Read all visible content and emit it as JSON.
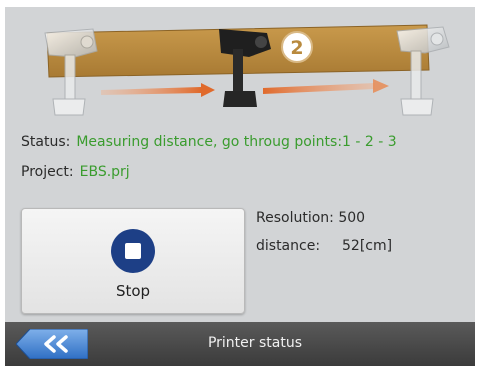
{
  "colors": {
    "screen_bg": "#d2d4d6",
    "status_green": "#3a9c2e",
    "accent_blue": "#1d3f86",
    "bar_dark": "#3b3b3b",
    "beam": "#b98a3e",
    "arrow": "#e8874a"
  },
  "illustration": {
    "step_number": "2"
  },
  "status": {
    "label": "Status:",
    "value": "Measuring distance, go throug points:1 - 2 - 3"
  },
  "project": {
    "label": "Project:",
    "value": "EBS.prj"
  },
  "stop_button": {
    "label": "Stop",
    "icon": "stop-icon"
  },
  "info": {
    "resolution_label": "Resolution:",
    "resolution_value": "500",
    "distance_label": "distance:",
    "distance_value": "52[cm]"
  },
  "bottom_bar": {
    "title": "Printer status",
    "back_icon": "double-chevron-left-icon"
  }
}
